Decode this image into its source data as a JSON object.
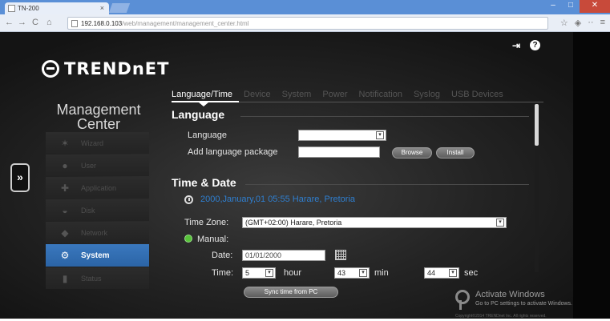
{
  "browser": {
    "tab_title": "TN-200",
    "url_host": "192.168.0.103",
    "url_path": "/web/management/management_center.html"
  },
  "header": {
    "logo_text": "TRENDnET"
  },
  "sidebar": {
    "title_line1": "Management",
    "title_line2": "Center",
    "items": [
      {
        "label": "Wizard",
        "icon": "wand-icon"
      },
      {
        "label": "User",
        "icon": "user-icon"
      },
      {
        "label": "Application",
        "icon": "puzzle-icon"
      },
      {
        "label": "Disk",
        "icon": "disk-icon"
      },
      {
        "label": "Network",
        "icon": "network-icon"
      },
      {
        "label": "System",
        "icon": "system-gear-icon",
        "active": true
      },
      {
        "label": "Status",
        "icon": "status-bars-icon"
      }
    ]
  },
  "tabs": [
    "Language/Time",
    "Device",
    "System",
    "Power",
    "Notification",
    "Syslog",
    "USB Devices"
  ],
  "language_section": {
    "heading": "Language",
    "language_label": "Language",
    "language_value": "",
    "add_package_label": "Add language package",
    "add_package_value": "",
    "browse_label": "Browse",
    "install_label": "Install"
  },
  "time_section": {
    "heading": "Time & Date",
    "current_datetime": "2000,January,01  05:55  Harare, Pretoria",
    "timezone_label": "Time Zone:",
    "timezone_value": "(GMT+02:00) Harare, Pretoria",
    "manual_label": "Manual:",
    "date_label": "Date:",
    "date_value": "01/01/2000",
    "time_label": "Time:",
    "hour_value": "5",
    "hour_unit": "hour",
    "min_value": "43",
    "min_unit": "min",
    "sec_value": "44",
    "sec_unit": "sec",
    "sync_label": "Sync time from PC"
  },
  "watermark": {
    "title": "Activate Windows",
    "subtitle": "Go to PC settings to activate Windows.",
    "copyright": "Copyright©2014 TRENDnet Inc. All rights reserved."
  },
  "colors": {
    "accent": "#2f7fd0",
    "active_side": "#3373b8",
    "radio": "#57c43a"
  }
}
